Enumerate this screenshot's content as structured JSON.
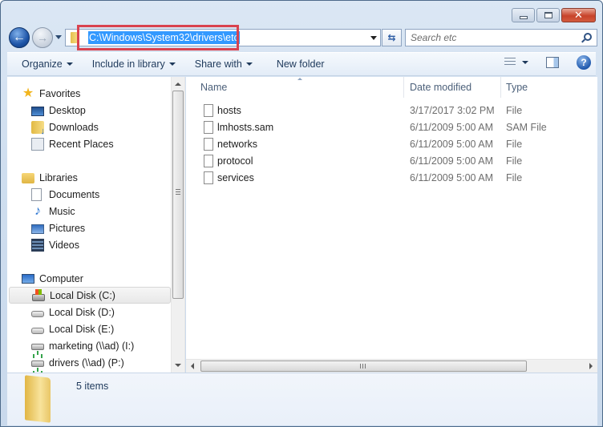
{
  "window": {
    "caption_buttons": {
      "minimize": "minimize",
      "maximize": "maximize",
      "close": "✕"
    }
  },
  "navigation": {
    "back_glyph": "←",
    "forward_glyph": "→",
    "address": "C:\\Windows\\System32\\drivers\\etc",
    "refresh_glyph": "⇆",
    "search_placeholder": "Search etc"
  },
  "toolbar": {
    "organize": "Organize",
    "include_in_library": "Include in library",
    "share_with": "Share with",
    "new_folder": "New folder",
    "help_glyph": "?"
  },
  "sidebar": {
    "favorites": {
      "label": "Favorites",
      "items": [
        {
          "label": "Desktop",
          "icon": "desktop-icon"
        },
        {
          "label": "Downloads",
          "icon": "downloads-icon"
        },
        {
          "label": "Recent Places",
          "icon": "recent-places-icon"
        }
      ]
    },
    "libraries": {
      "label": "Libraries",
      "items": [
        {
          "label": "Documents",
          "icon": "documents-icon"
        },
        {
          "label": "Music",
          "icon": "music-icon"
        },
        {
          "label": "Pictures",
          "icon": "pictures-icon"
        },
        {
          "label": "Videos",
          "icon": "videos-icon"
        }
      ]
    },
    "computer": {
      "label": "Computer",
      "items": [
        {
          "label": "Local Disk (C:)",
          "icon": "system-disk-icon",
          "selected": true
        },
        {
          "label": "Local Disk (D:)",
          "icon": "disk-icon"
        },
        {
          "label": "Local Disk (E:)",
          "icon": "disk-icon"
        },
        {
          "label": "marketing (\\\\ad) (I:)",
          "icon": "network-drive-icon"
        },
        {
          "label": "drivers (\\\\ad) (P:)",
          "icon": "network-drive-icon"
        }
      ]
    }
  },
  "file_list": {
    "columns": [
      "Name",
      "Date modified",
      "Type"
    ],
    "rows": [
      {
        "name": "hosts",
        "date": "3/17/2017 3:02 PM",
        "type": "File"
      },
      {
        "name": "lmhosts.sam",
        "date": "6/11/2009 5:00 AM",
        "type": "SAM File"
      },
      {
        "name": "networks",
        "date": "6/11/2009 5:00 AM",
        "type": "File"
      },
      {
        "name": "protocol",
        "date": "6/11/2009 5:00 AM",
        "type": "File"
      },
      {
        "name": "services",
        "date": "6/11/2009 5:00 AM",
        "type": "File"
      }
    ]
  },
  "details": {
    "status": "5 items"
  },
  "colors": {
    "highlight_box": "#d9434f",
    "address_selection": "#3399ff"
  }
}
